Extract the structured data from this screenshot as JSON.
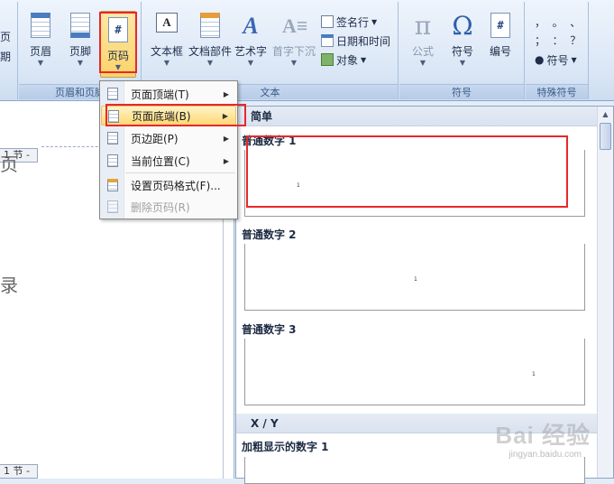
{
  "ribbon": {
    "group_header_footer": {
      "label": "页眉和页脚",
      "header_btn": "页眉",
      "footer_btn": "页脚",
      "page_number_btn": "页码",
      "left_partial": "页\n期"
    },
    "group_text": {
      "label": "文本",
      "textbox_btn": "文本框",
      "quickparts_btn": "文档部件",
      "wordart_btn": "艺术字",
      "dropcap_btn": "首字下沉",
      "signature_line": "签名行",
      "date_time": "日期和时间",
      "object": "对象"
    },
    "group_symbols": {
      "label": "符号",
      "equation_btn": "公式",
      "symbol_btn": "符号",
      "numbering_btn": "编号",
      "equation_glyph": "π",
      "symbol_glyph": "Ω"
    },
    "group_special": {
      "label": "特殊符号",
      "symbol_dropdown": "符号",
      "chars_row1": "，  。  、",
      "chars_row2": "；  ：  ？"
    }
  },
  "menu": {
    "items": [
      {
        "label": "页面顶端(T)",
        "has_submenu": true
      },
      {
        "label": "页面底端(B)",
        "has_submenu": true
      },
      {
        "label": "页边距(P)",
        "has_submenu": true
      },
      {
        "label": "当前位置(C)",
        "has_submenu": true
      },
      {
        "label": "设置页码格式(F)...",
        "has_submenu": false
      },
      {
        "label": "删除页码(R)",
        "has_submenu": false,
        "disabled": true
      }
    ]
  },
  "document": {
    "section_tag_top": "1 节 -",
    "section_tag_bottom": "1 节 -",
    "char_top": "页",
    "char_mid": "录"
  },
  "gallery": {
    "category_simple": "简单",
    "category_xy": "X / Y",
    "items": [
      {
        "title": "普通数字 1",
        "num": "1"
      },
      {
        "title": "普通数字 2",
        "num": "1"
      },
      {
        "title": "普通数字 3",
        "num": "1"
      },
      {
        "title": "加粗显示的数字 1"
      }
    ]
  },
  "watermark": {
    "text": "Bai 经验",
    "sub": "jingyan.baidu.com"
  },
  "colors": {
    "highlight_border": "#e8282b",
    "menu_highlight": "#ffd874",
    "ribbon_bg": "#dbe7f6"
  }
}
